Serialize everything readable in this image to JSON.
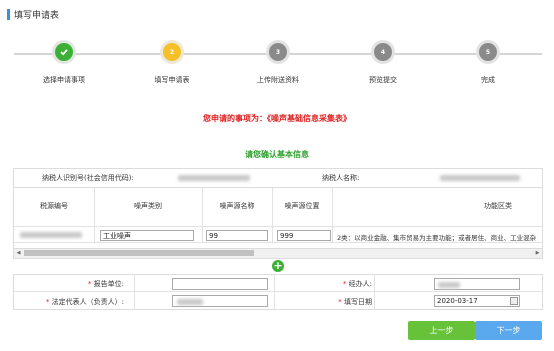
{
  "page": {
    "title": "填写申请表"
  },
  "steps": [
    {
      "index": "1",
      "label": "选择申请事项",
      "status": "done"
    },
    {
      "index": "2",
      "label": "填写申请表",
      "status": "current"
    },
    {
      "index": "3",
      "label": "上传附送资料",
      "status": "todo"
    },
    {
      "index": "4",
      "label": "预览提交",
      "status": "todo"
    },
    {
      "index": "5",
      "label": "完成",
      "status": "todo"
    }
  ],
  "notice": "您申请的事项为：《噪声基础信息采集表》",
  "section_title": "请您确认基本信息",
  "taxpayer": {
    "id_label": "纳税人识别号(社会信用代码):",
    "name_label": "纳税人名称:"
  },
  "table": {
    "headers": [
      "税源编号",
      "噪声类别",
      "噪声源名称",
      "噪声源位置",
      "功能区类"
    ],
    "row": {
      "noise_type": "工业噪声",
      "source_name": "99",
      "source_location": "999",
      "zone_desc": "2类：以商业金融、集市贸易为主要功能；或者居住、商业、工业混杂"
    }
  },
  "form": {
    "report_unit_label": "报告单位:",
    "handler_label": "经办人:",
    "legal_rep_label": "法定代表人（负责人）:",
    "fill_date_label": "填写日期",
    "fill_date_value": "2020-03-17"
  },
  "buttons": {
    "prev": "上一步",
    "next": "下一步"
  },
  "colors": {
    "accent": "#3a8ee6",
    "done": "#3cb034",
    "current": "#f5c028",
    "notice": "#e01c1c",
    "prev_btn": "#67c23a",
    "next_btn": "#5aa9ef"
  }
}
